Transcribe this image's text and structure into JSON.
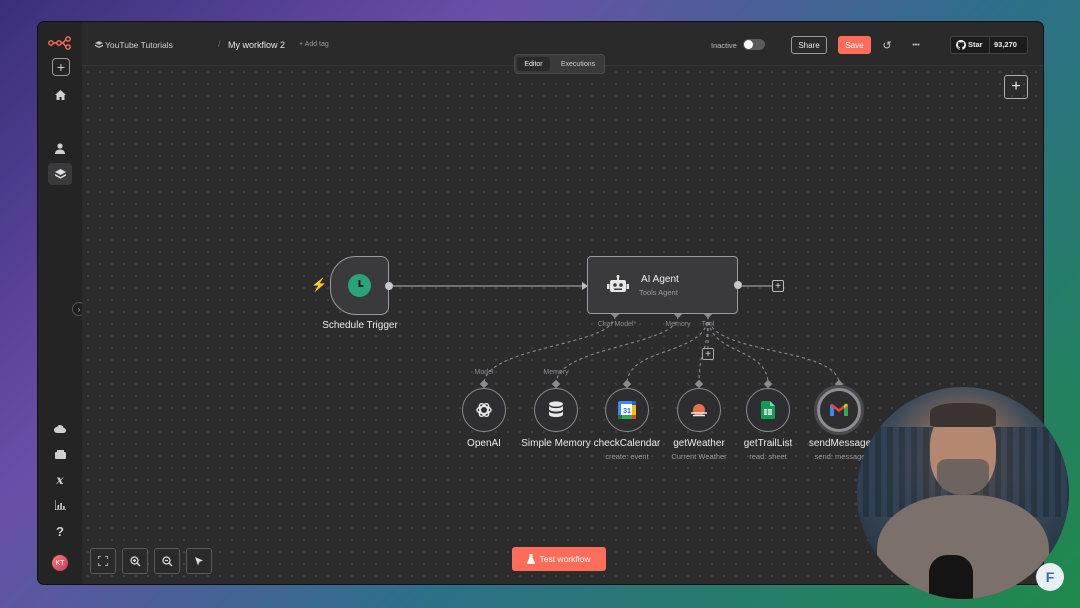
{
  "app": {
    "project": "YouTube Tutorials",
    "workflow_name": "My workflow 2",
    "add_tag": "+ Add tag",
    "status_label": "Inactive",
    "share_label": "Share",
    "save_label": "Save",
    "more_label": "•••",
    "github_star": "Star",
    "github_count": "93,270"
  },
  "tabs": {
    "editor": "Editor",
    "executions": "Executions"
  },
  "nodes": {
    "schedule": {
      "label": "Schedule Trigger"
    },
    "agent": {
      "title": "AI Agent",
      "subtitle": "Tools Agent"
    },
    "ports": {
      "chat_model": "Chat Model*",
      "memory": "Memory",
      "tool": "Tool"
    },
    "openai": {
      "label": "OpenAI",
      "port": "Model"
    },
    "memory": {
      "label": "Simple Memory",
      "port": "Memory"
    },
    "calendar": {
      "label": "checkCalendar",
      "sub": "create: event"
    },
    "weather": {
      "label": "getWeather",
      "sub": "Current Weather"
    },
    "trail": {
      "label": "getTrailList",
      "sub": "read: sheet"
    },
    "send": {
      "label": "sendMessage",
      "sub": "send: message"
    }
  },
  "footer": {
    "test_workflow": "Test workflow"
  },
  "colors": {
    "accent": "#ff6d5a",
    "trigger_green": "#2aa37a",
    "canvas": "#2c2c2d"
  }
}
